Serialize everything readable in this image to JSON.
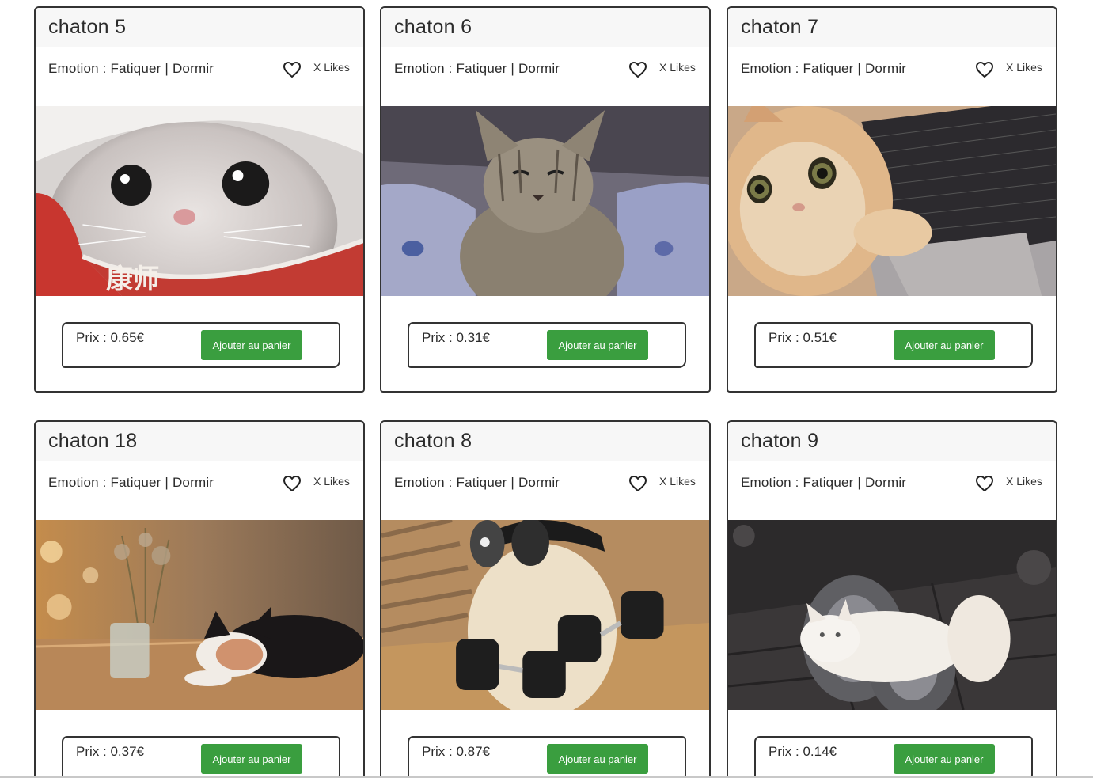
{
  "cards": [
    {
      "title": "chaton 5",
      "emotion": "Emotion : Fatiquer | Dormir",
      "likes": "X Likes",
      "price": "Prix : 0.65€",
      "button": "Ajouter au panier",
      "photo_icon": "kitten-in-cup-photo"
    },
    {
      "title": "chaton 6",
      "emotion": "Emotion : Fatiquer | Dormir",
      "likes": "X Likes",
      "price": "Prix : 0.31€",
      "button": "Ajouter au panier",
      "photo_icon": "grumpy-kitten-photo"
    },
    {
      "title": "chaton 7",
      "emotion": "Emotion : Fatiquer | Dormir",
      "likes": "X Likes",
      "price": "Prix : 0.51€",
      "button": "Ajouter au panier",
      "photo_icon": "cat-on-laptop-photo"
    },
    {
      "title": "chaton 18",
      "emotion": "Emotion : Fatiquer | Dormir",
      "likes": "X Likes",
      "price": "Prix : 0.37€",
      "button": "Ajouter au panier",
      "photo_icon": "sleeping-cat-table-photo"
    },
    {
      "title": "chaton 8",
      "emotion": "Emotion : Fatiquer | Dormir",
      "likes": "X Likes",
      "price": "Prix : 0.87€",
      "button": "Ajouter au panier",
      "photo_icon": "kitten-with-dumbbells-photo"
    },
    {
      "title": "chaton 9",
      "emotion": "Emotion : Fatiquer | Dormir",
      "likes": "X Likes",
      "price": "Prix : 0.14€",
      "button": "Ajouter au panier",
      "photo_icon": "kitten-on-dumbbell-photo"
    }
  ],
  "colors": {
    "button_green": "#3a9e3f",
    "title_bar": "#f7f7f7",
    "border": "#333333"
  }
}
